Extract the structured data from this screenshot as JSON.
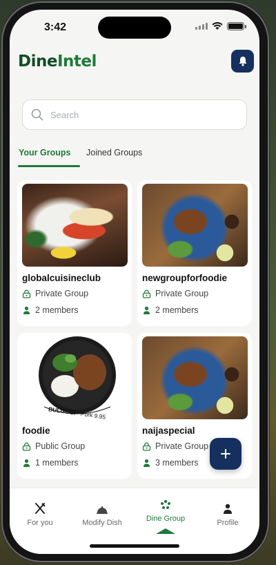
{
  "status_bar": {
    "time": "3:42"
  },
  "app": {
    "logo_part1": "Dine",
    "logo_part2": "Intel"
  },
  "search": {
    "placeholder": "Search"
  },
  "tabs": [
    {
      "label": "Your Groups",
      "active": true
    },
    {
      "label": "Joined Groups",
      "active": false
    }
  ],
  "groups": [
    {
      "name": "globalcuisineclub",
      "privacy": "Private Group",
      "members": "2 members",
      "image": "lobster-tail-dish"
    },
    {
      "name": "newgroupforfoodie",
      "privacy": "Private Group",
      "members": "2 members",
      "image": "grilled-chicken-plate"
    },
    {
      "name": "foodie",
      "privacy": "Public Group",
      "members": "1 members",
      "image": "bulgogi-plate"
    },
    {
      "name": "naijaspecial",
      "privacy": "Private Group",
      "members": "3 members",
      "image": "grilled-chicken-plate"
    }
  ],
  "bulgogi_caption": {
    "title": "BULGOGI",
    "sub": "- Pork 9.95"
  },
  "bottom_nav": [
    {
      "label": "For you",
      "icon": "cutlery-icon",
      "active": false
    },
    {
      "label": "Modify Dish",
      "icon": "cloche-icon",
      "active": false
    },
    {
      "label": "Dine Group",
      "icon": "group-icon",
      "active": true
    },
    {
      "label": "Profile",
      "icon": "person-icon",
      "active": false
    }
  ],
  "colors": {
    "brand_green": "#1f7a3a",
    "navy": "#15305e"
  }
}
